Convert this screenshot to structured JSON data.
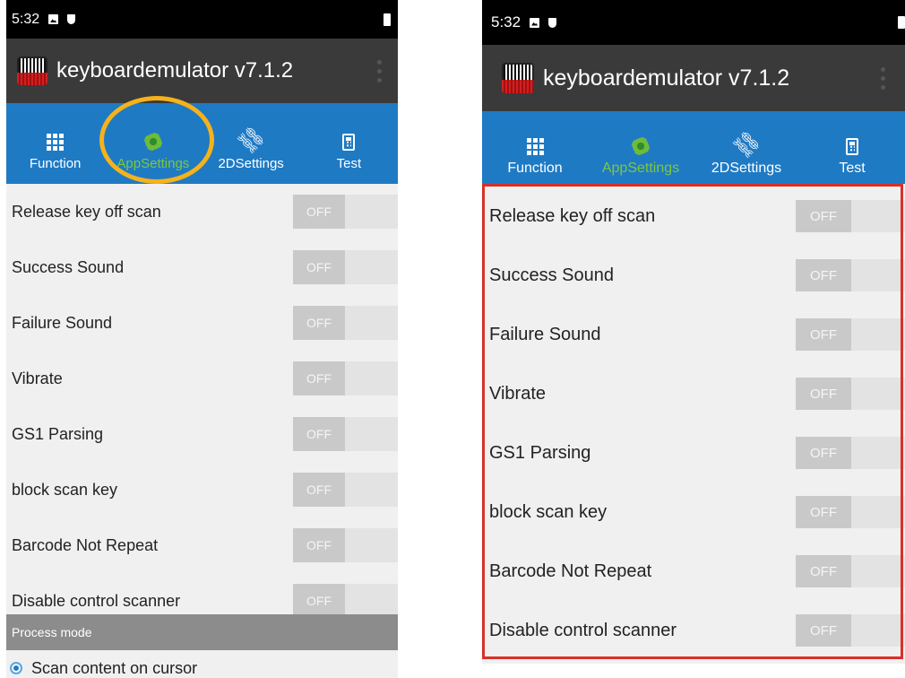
{
  "status_bar": {
    "left_time": "5:32",
    "right_time": "5:32"
  },
  "app": {
    "title": "keyboardemulator v7.1.2"
  },
  "tabs": [
    {
      "label": "Function",
      "icon": "grid-icon"
    },
    {
      "label": "AppSettings",
      "icon": "gear-icon"
    },
    {
      "label": "2DSettings",
      "icon": "link-icon"
    },
    {
      "label": "Test",
      "icon": "calculator-icon"
    }
  ],
  "settings": [
    {
      "label": "Release key off scan",
      "state": "OFF"
    },
    {
      "label": "Success Sound",
      "state": "OFF"
    },
    {
      "label": "Failure Sound",
      "state": "OFF"
    },
    {
      "label": "Vibrate",
      "state": "OFF"
    },
    {
      "label": "GS1 Parsing",
      "state": "OFF"
    },
    {
      "label": "block scan key",
      "state": "OFF"
    },
    {
      "label": "Barcode Not Repeat",
      "state": "OFF"
    },
    {
      "label": "Disable control scanner",
      "state": "OFF"
    }
  ],
  "process_mode": {
    "header": "Process mode",
    "option": "Scan content on cursor"
  },
  "colors": {
    "tab_bar": "#1f7ac4",
    "active_tab": "#7cc83b",
    "highlight_circle": "#f5b21b",
    "highlight_rect": "#d9302a"
  }
}
